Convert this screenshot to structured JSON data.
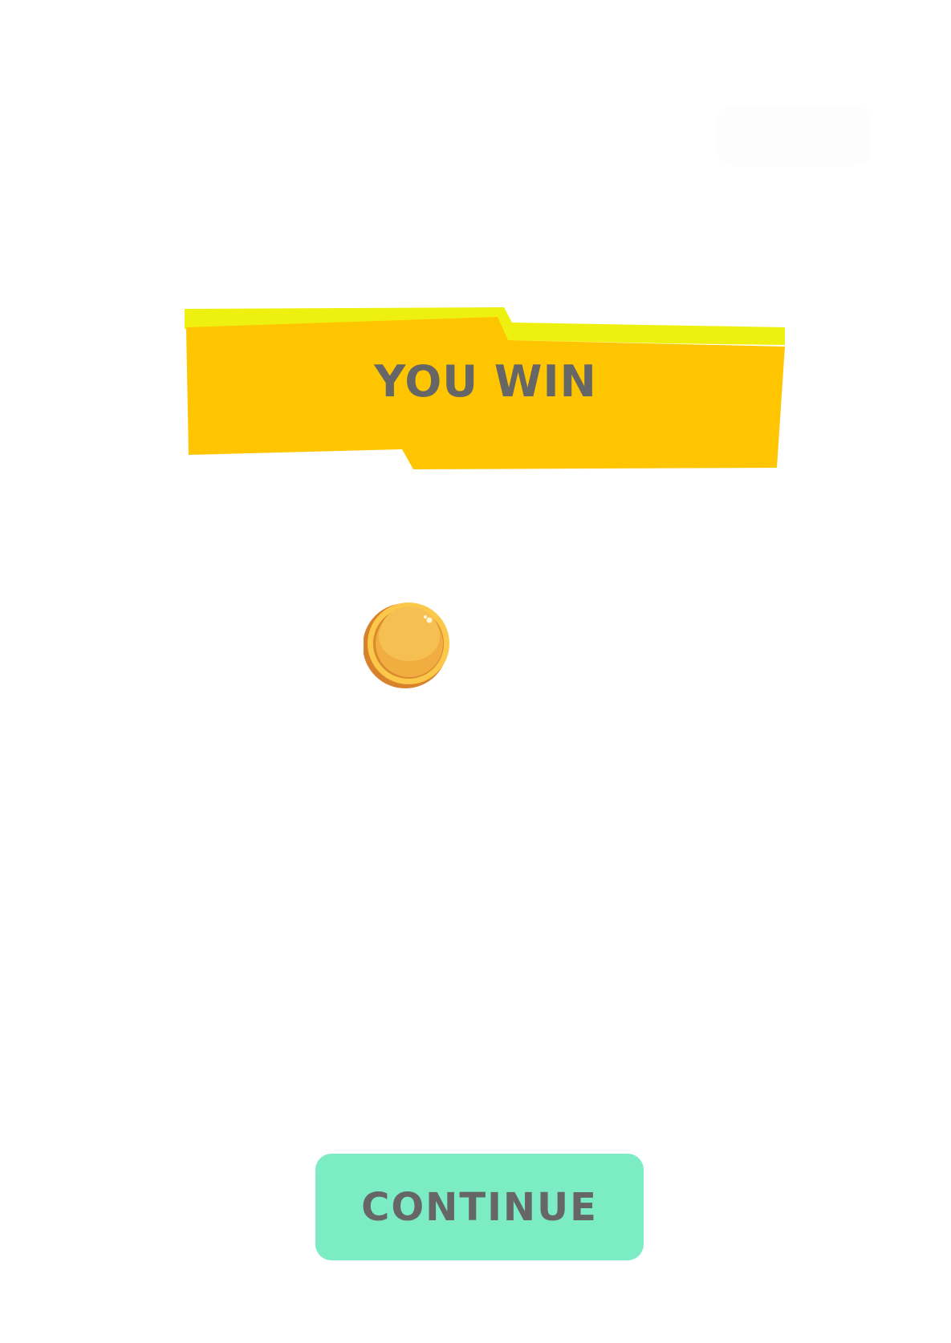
{
  "result": {
    "title": "YOU WIN"
  },
  "reward": {
    "icon": "coin-icon"
  },
  "actions": {
    "continue_label": "CONTINUE"
  },
  "colors": {
    "banner_main": "#ffc500",
    "banner_highlight": "#eef00f",
    "button_bg": "#7cecc4",
    "text": "#666666"
  }
}
